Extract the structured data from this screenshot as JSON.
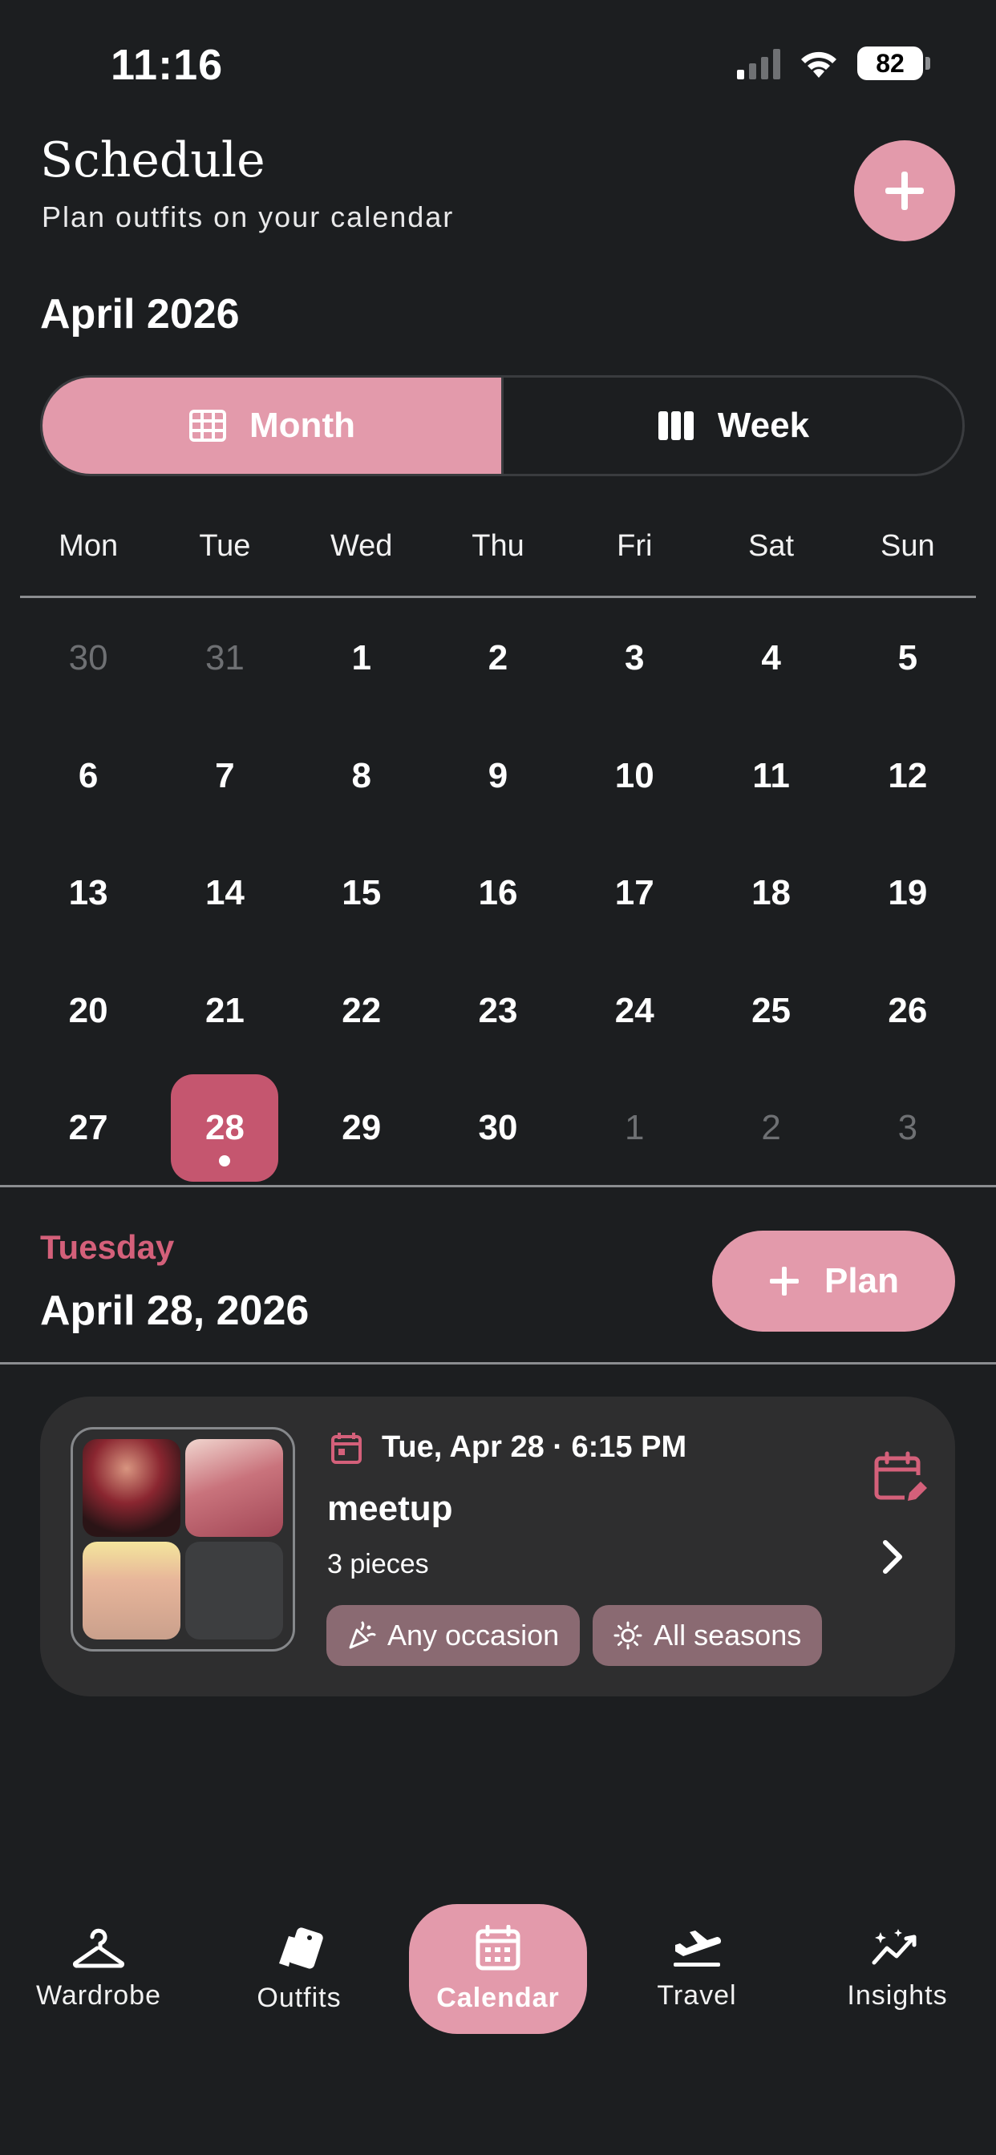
{
  "status": {
    "time": "11:16",
    "battery": "82"
  },
  "header": {
    "title": "Schedule",
    "subtitle": "Plan outfits on your calendar"
  },
  "calendar": {
    "month_label": "April 2026",
    "view_toggle": {
      "month": "Month",
      "week": "Week",
      "selected": "Month"
    },
    "weekdays": [
      "Mon",
      "Tue",
      "Wed",
      "Thu",
      "Fri",
      "Sat",
      "Sun"
    ],
    "weeks": [
      [
        "30",
        "31",
        "1",
        "2",
        "3",
        "4",
        "5"
      ],
      [
        "6",
        "7",
        "8",
        "9",
        "10",
        "11",
        "12"
      ],
      [
        "13",
        "14",
        "15",
        "16",
        "17",
        "18",
        "19"
      ],
      [
        "20",
        "21",
        "22",
        "23",
        "24",
        "25",
        "26"
      ],
      [
        "27",
        "28",
        "29",
        "30",
        "1",
        "2",
        "3"
      ]
    ],
    "selected_day": "28"
  },
  "selected": {
    "day_name": "Tuesday",
    "date": "April 28, 2026",
    "plan_button": "Plan"
  },
  "outfit": {
    "datetime": "Tue, Apr 28 · 6:15 PM",
    "title": "meetup",
    "pieces": "3 pieces",
    "chips": [
      "Any occasion",
      "All seasons"
    ]
  },
  "tabs": [
    {
      "label": "Wardrobe",
      "icon": "hanger-icon"
    },
    {
      "label": "Outfits",
      "icon": "outfits-icon"
    },
    {
      "label": "Calendar",
      "icon": "calendar-icon",
      "active": true
    },
    {
      "label": "Travel",
      "icon": "plane-icon"
    },
    {
      "label": "Insights",
      "icon": "insights-icon"
    }
  ],
  "colors": {
    "accent": "#e39aab",
    "selected_day": "#c5566f",
    "day_name": "#d4607a",
    "background": "#1c1e20"
  }
}
